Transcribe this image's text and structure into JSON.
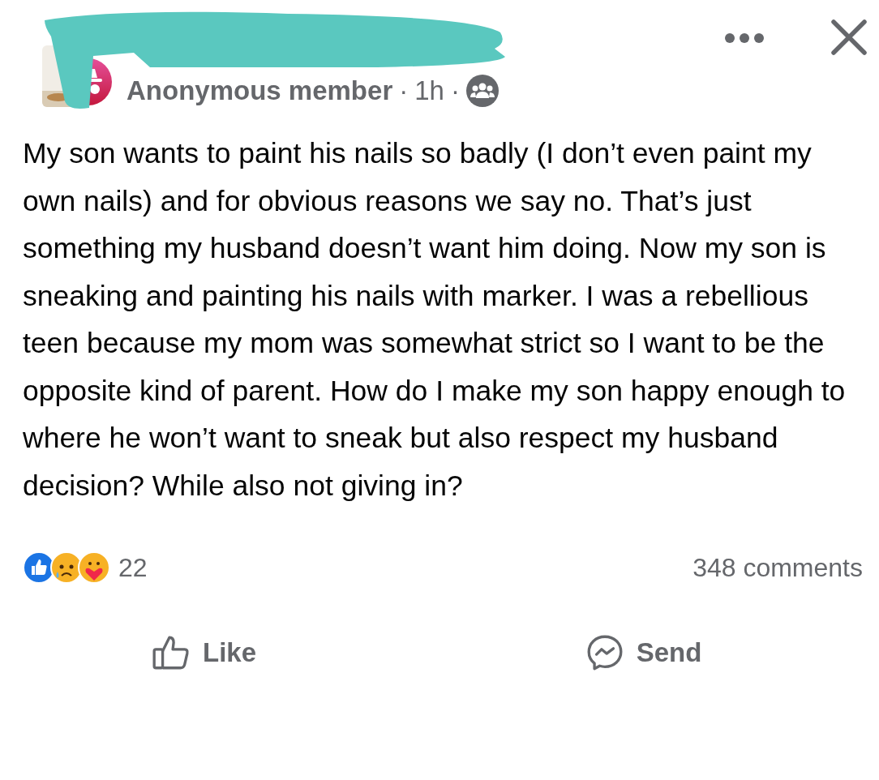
{
  "header": {
    "author": "Anonymous member",
    "separators": [
      "·",
      "·"
    ],
    "time": "1h"
  },
  "post": {
    "text": "My son wants to paint his nails so badly (I don’t even paint my own nails) and for obvious reasons we say no. That’s just something my husband doesn’t want him doing. Now my son is sneaking and painting his nails with marker. I was a rebellious teen because my mom was somewhat strict so I want to be the opposite kind of parent. How do I make my son happy enough to where he won’t want to sneak but also respect my husband decision? While also not giving in?"
  },
  "stats": {
    "reaction_count": "22",
    "comments": "348 comments"
  },
  "actions": [
    {
      "kind": "like",
      "label": "Like"
    },
    {
      "kind": "send",
      "label": "Send"
    }
  ]
}
